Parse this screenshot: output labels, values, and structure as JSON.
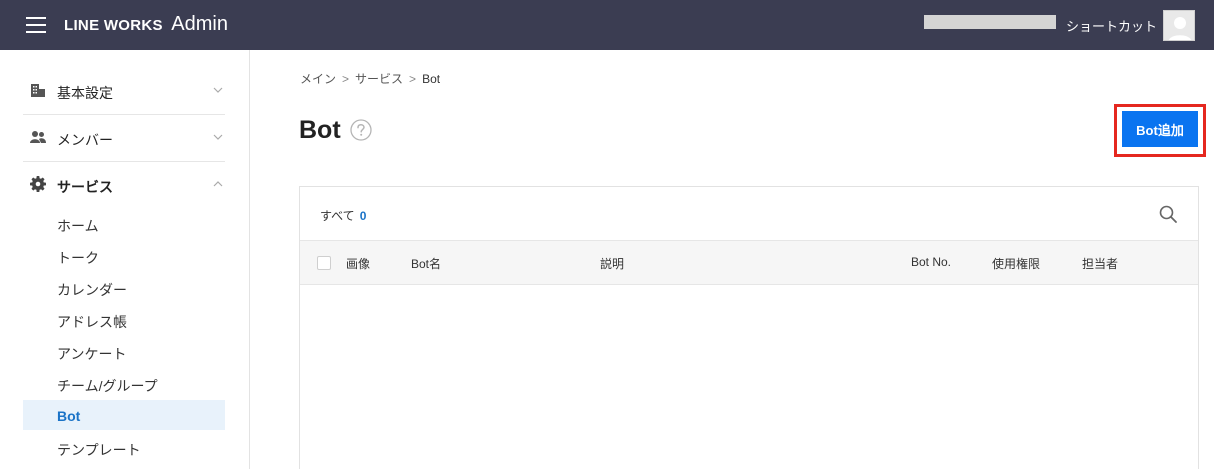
{
  "header": {
    "brand_name": "LINE WORKS",
    "brand_suffix": "Admin",
    "shortcut_label": "ショートカット",
    "background": "#3b3d52"
  },
  "sidebar": {
    "sections": [
      {
        "label": "基本設定",
        "icon": "building-icon",
        "expanded": false
      },
      {
        "label": "メンバー",
        "icon": "members-icon",
        "expanded": false
      },
      {
        "label": "サービス",
        "icon": "gear-icon",
        "expanded": true
      }
    ],
    "service_items": [
      {
        "label": "ホーム",
        "active": false
      },
      {
        "label": "トーク",
        "active": false
      },
      {
        "label": "カレンダー",
        "active": false
      },
      {
        "label": "アドレス帳",
        "active": false
      },
      {
        "label": "アンケート",
        "active": false
      },
      {
        "label": "チーム/グループ",
        "active": false
      },
      {
        "label": "Bot",
        "active": true
      },
      {
        "label": "テンプレート",
        "active": false
      }
    ]
  },
  "breadcrumb": {
    "items": [
      "メイン",
      "サービス",
      "Bot"
    ],
    "separator": ">"
  },
  "page": {
    "title": "Bot",
    "add_button_label": "Bot追加",
    "accent_color": "#0a74f0",
    "highlight_color": "#e5271f"
  },
  "list": {
    "filter_label": "すべて",
    "count": "0",
    "columns": [
      "画像",
      "Bot名",
      "説明",
      "Bot No.",
      "使用権限",
      "担当者"
    ],
    "rows": []
  }
}
